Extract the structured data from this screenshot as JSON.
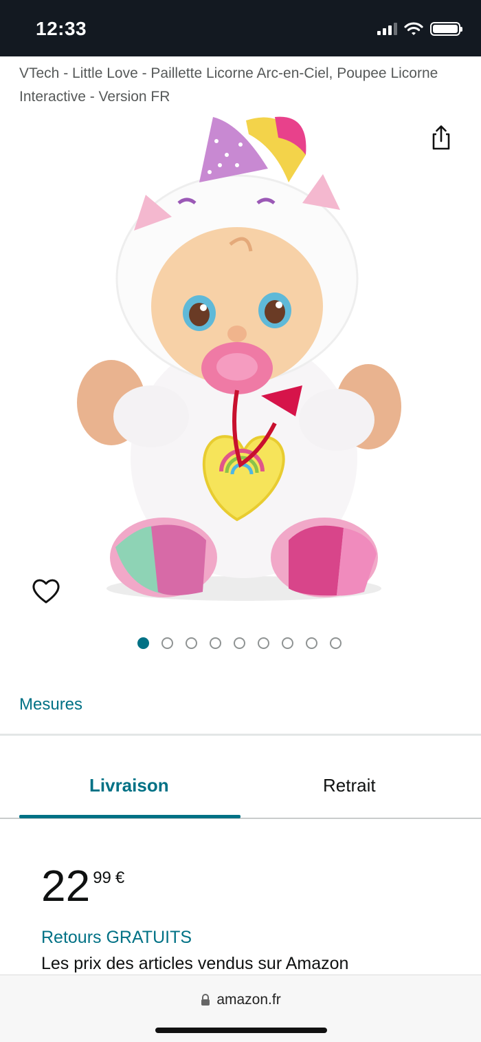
{
  "status_bar": {
    "time": "12:33"
  },
  "product": {
    "title": "VTech - Little Love - Paillette Licorne Arc-en-Ciel, Poupee Licorne Interactive - Version FR",
    "image_alt": "Poupée licorne interactive",
    "gallery": {
      "count": 9,
      "active_index": 0
    }
  },
  "links": {
    "measures": "Mesures"
  },
  "tabs": [
    {
      "label": "Livraison",
      "active": true
    },
    {
      "label": "Retrait",
      "active": false
    }
  ],
  "price": {
    "whole": "22",
    "fraction": "99",
    "currency": "€"
  },
  "returns": "Retours GRATUITS",
  "price_note": "Les prix des articles vendus sur Amazon",
  "browser": {
    "url": "amazon.fr"
  },
  "colors": {
    "accent": "#007185",
    "status_bar": "#131921"
  },
  "icons": [
    "signal-icon",
    "wifi-icon",
    "battery-icon",
    "share-icon",
    "heart-icon",
    "lock-icon"
  ]
}
